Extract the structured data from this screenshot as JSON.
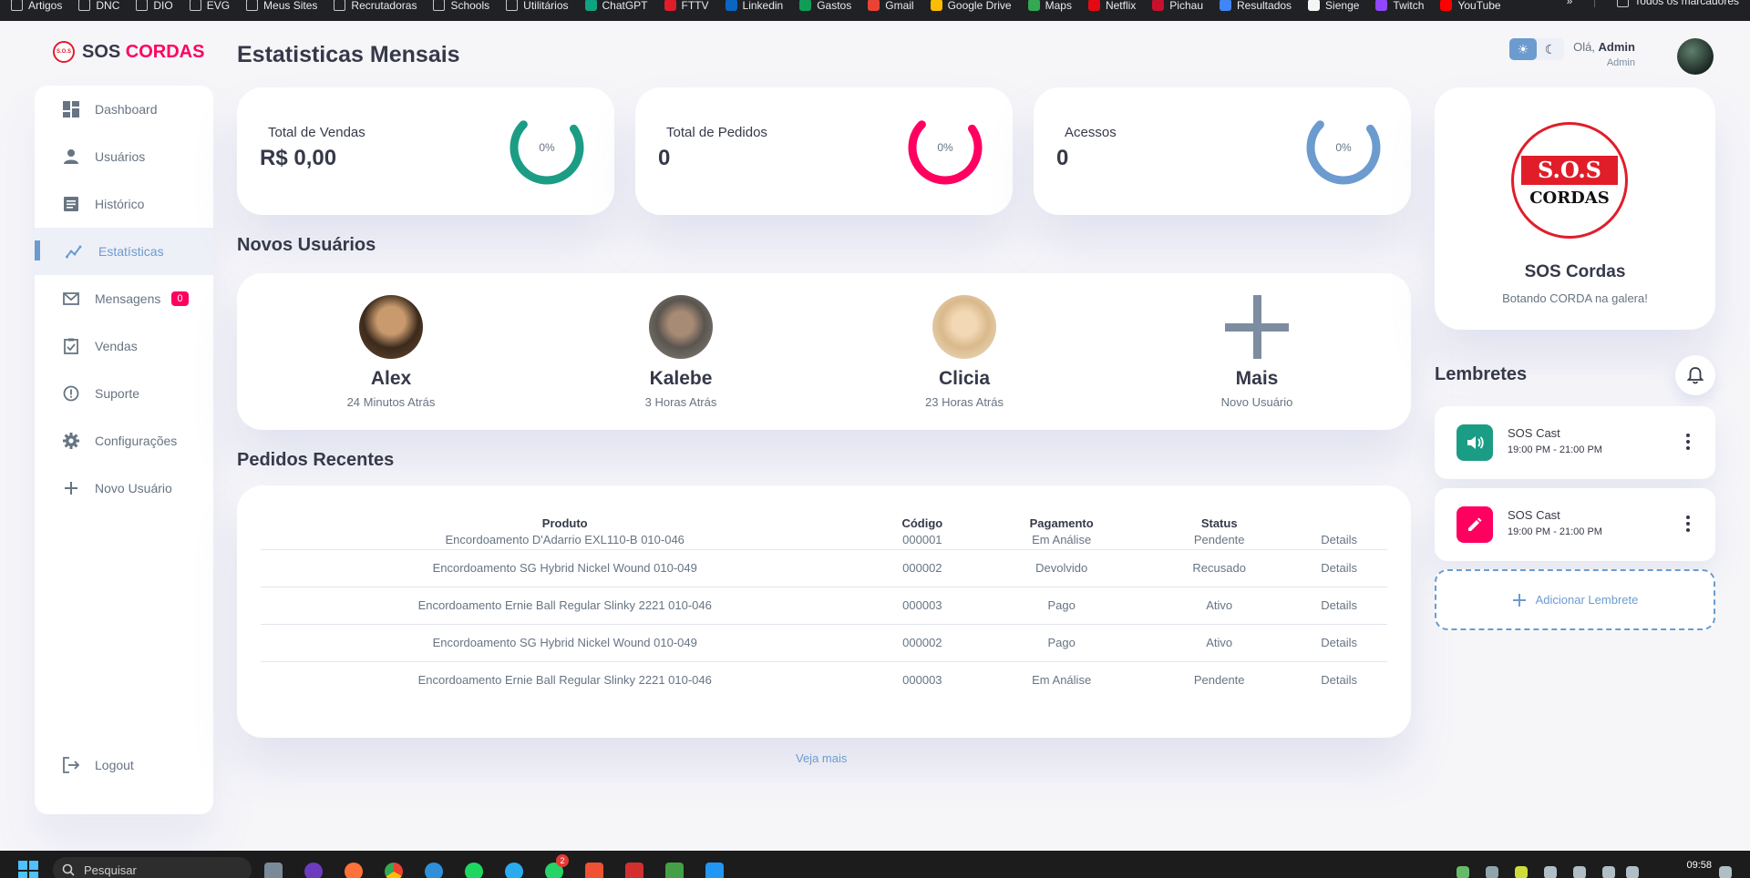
{
  "bookmarks": [
    "Artigos",
    "DNC",
    "DIO",
    "EVG",
    "Meus Sites",
    "Recrutadoras",
    "Schools",
    "Utilitários",
    "ChatGPT",
    "FTTV",
    "Linkedin",
    "Gastos",
    "Gmail",
    "Google Drive",
    "Maps",
    "Netflix",
    "Pichau",
    "Resultados",
    "Sienge",
    "Twitch",
    "YouTube"
  ],
  "bookmarks_more": "»",
  "bookmarks_all": "Todos os marcadores",
  "logo": {
    "text_main": "SOS ",
    "text_accent": "CORDAS",
    "mini_text": "S.O.S"
  },
  "sidebar": {
    "items": [
      {
        "label": "Dashboard",
        "icon": "dashboard-icon"
      },
      {
        "label": "Usuários",
        "icon": "person-icon"
      },
      {
        "label": "Histórico",
        "icon": "receipt-icon"
      },
      {
        "label": "Estatísticas",
        "icon": "insights-icon"
      },
      {
        "label": "Mensagens",
        "icon": "mail-icon",
        "badge": "0"
      },
      {
        "label": "Vendas",
        "icon": "inventory-icon"
      },
      {
        "label": "Suporte",
        "icon": "report-icon"
      },
      {
        "label": "Configurações",
        "icon": "settings-icon"
      },
      {
        "label": "Novo Usuário",
        "icon": "add-icon"
      }
    ],
    "logout": "Logout"
  },
  "header": {
    "title": "Estatisticas Mensais",
    "greeting": "Olá, ",
    "user": "Admin",
    "role": "Admin"
  },
  "stats": [
    {
      "label": "Total de Vendas",
      "value": "R$ 0,00",
      "percent": "0%",
      "color": "#1b9c85",
      "fill": 0.72
    },
    {
      "label": "Total de Pedidos",
      "value": "0",
      "percent": "0%",
      "color": "#ff0060",
      "fill": 0.72
    },
    {
      "label": "Acessos",
      "value": "0",
      "percent": "0%",
      "color": "#6c9bcf",
      "fill": 0.72
    }
  ],
  "new_users": {
    "title": "Novos Usuários",
    "users": [
      {
        "name": "Alex",
        "time": "24 Minutos Atrás"
      },
      {
        "name": "Kalebe",
        "time": "3 Horas Atrás"
      },
      {
        "name": "Clicia",
        "time": "23 Horas Atrás"
      },
      {
        "name": "Mais",
        "time": "Novo Usuário"
      }
    ]
  },
  "orders": {
    "title": "Pedidos Recentes",
    "columns": [
      "Produto",
      "Código",
      "Pagamento",
      "Status",
      ""
    ],
    "rows": [
      {
        "produto": "Encordoamento D'Adarrio EXL110-B 010-046",
        "codigo": "000001",
        "pagamento": "Em Análise",
        "status": "Pendente",
        "status_class": "st-danger",
        "details": "Details"
      },
      {
        "produto": "Encordoamento SG Hybrid Nickel Wound 010-049",
        "codigo": "000002",
        "pagamento": "Devolvido",
        "status": "Recusado",
        "status_class": "st-warning",
        "details": "Details"
      },
      {
        "produto": "Encordoamento Ernie Ball Regular Slinky 2221 010-046",
        "codigo": "000003",
        "pagamento": "Pago",
        "status": "Ativo",
        "status_class": "st-primary",
        "details": "Details"
      },
      {
        "produto": "Encordoamento SG Hybrid Nickel Wound 010-049",
        "codigo": "000002",
        "pagamento": "Pago",
        "status": "Ativo",
        "status_class": "st-primary",
        "details": "Details"
      },
      {
        "produto": "Encordoamento Ernie Ball Regular Slinky 2221 010-046",
        "codigo": "000003",
        "pagamento": "Em Análise",
        "status": "Pendente",
        "status_class": "st-danger",
        "details": "Details"
      }
    ],
    "see_more": "Veja mais"
  },
  "brand": {
    "seal_top": "S.O.S",
    "seal_bottom": "CORDAS",
    "name": "SOS Cordas",
    "tagline": "Botando CORDA na galera!"
  },
  "reminders": {
    "title": "Lembretes",
    "items": [
      {
        "title": "SOS Cast",
        "time": "19:00 PM - 21:00 PM",
        "icon": "volume-icon",
        "color": "#1b9c85"
      },
      {
        "title": "SOS Cast",
        "time": "19:00 PM - 21:00 PM",
        "icon": "edit-icon",
        "color": "#ff0060"
      }
    ],
    "add_label": "Adicionar Lembrete"
  },
  "taskbar": {
    "search_placeholder": "Pesquisar",
    "time": "09:58",
    "notification_count": "2"
  },
  "colors": {
    "primary": "#6c9bcf",
    "danger": "#ff0060",
    "success": "#1b9c85",
    "warning": "#f7d060",
    "background": "#f6f6f9"
  }
}
